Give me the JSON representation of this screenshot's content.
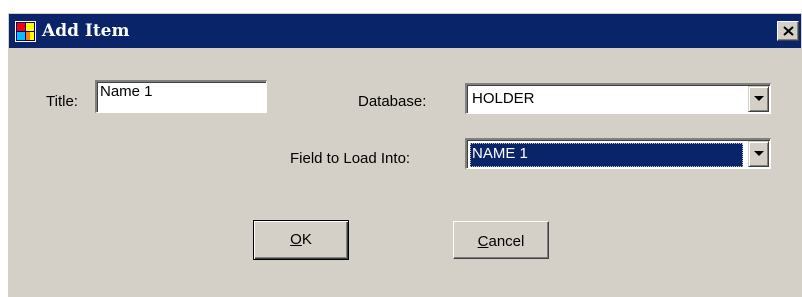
{
  "window": {
    "title": "Add Item",
    "app_icon": "window-app-icon",
    "close_icon": "close-icon"
  },
  "form": {
    "title_label": "Title:",
    "title_value": "Name 1",
    "database_label": "Database:",
    "database_value": "HOLDER",
    "field_label": "Field to Load Into:",
    "field_value": "NAME 1"
  },
  "buttons": {
    "ok": {
      "mnemonic": "O",
      "rest": "K"
    },
    "cancel": {
      "mnemonic": "C",
      "rest": "ancel"
    }
  },
  "colors": {
    "titlebar": "#0a246a",
    "face": "#d4d0c8",
    "selection": "#0a246a"
  }
}
